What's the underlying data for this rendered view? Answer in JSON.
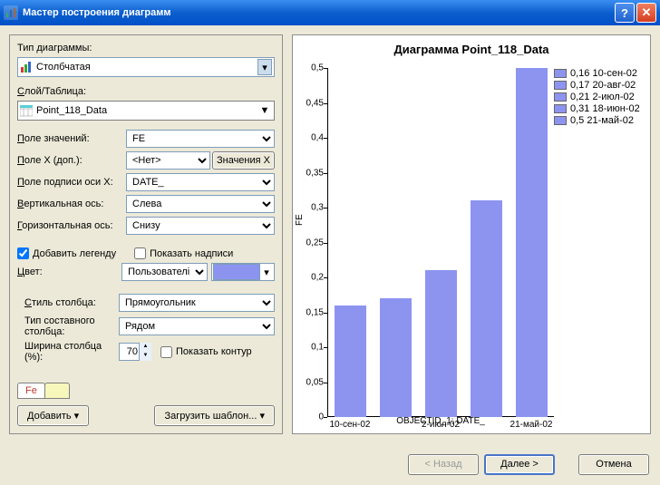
{
  "window": {
    "title": "Мастер построения диаграмм"
  },
  "labels": {
    "chart_type": "Тип диаграммы:",
    "layer_table": "Слой/Таблица:",
    "value_field": "Поле значений:",
    "x_field": "Поле X (доп.):",
    "x_axis_label_field": "Поле подписи оси X:",
    "vertical_axis": "Вертикальная ось:",
    "horizontal_axis": "Горизонтальная ось:",
    "add_legend": "Добавить легенду",
    "show_labels": "Показать надписи",
    "color": "Цвет:",
    "bar_style": "Стиль столбца:",
    "multibar_type": "Тип составного столбца:",
    "bar_width": "Ширина столбца (%):",
    "show_outline": "Показать контур",
    "x_btn": "Значения X",
    "add": "Добавить",
    "load_template": "Загрузить шаблон...",
    "back": "< Назад",
    "next": "Далее >",
    "cancel": "Отмена"
  },
  "values": {
    "chart_type": "Столбчатая",
    "layer_table": "Point_118_Data",
    "value_field": "FE",
    "x_field": "<Нет>",
    "x_axis_label_field": "DATE_",
    "vertical_axis": "Слева",
    "horizontal_axis": "Снизу",
    "add_legend_checked": true,
    "show_labels_checked": false,
    "color_mode": "Пользовательский",
    "color_hex": "#8d94f0",
    "bar_style": "Прямоугольник",
    "multibar_type": "Рядом",
    "bar_width": "70",
    "show_outline_checked": false,
    "tab": "Fe"
  },
  "chart_data": {
    "type": "bar",
    "title": "Диаграмма  Point_118_Data",
    "ylabel": "FE",
    "xlabel": "OBJECTID_1; DATE_",
    "ylim": [
      0,
      0.5
    ],
    "yticks": [
      0,
      0.05,
      0.1,
      0.15,
      0.2,
      0.25,
      0.3,
      0.35,
      0.4,
      0.45,
      0.5
    ],
    "ytick_labels": [
      "0",
      "0,05",
      "0,1",
      "0,15",
      "0,2",
      "0,25",
      "0,3",
      "0,35",
      "0,4",
      "0,45",
      "0,5"
    ],
    "categories": [
      "10-сен-02",
      "20-авг-02",
      "2-июл-02",
      "18-июн-02",
      "21-май-02"
    ],
    "x_tick_labels": [
      "10-сен-02",
      "2-июл-02",
      "21-май-02"
    ],
    "x_tick_positions": [
      0,
      2,
      4
    ],
    "values": [
      0.16,
      0.17,
      0.21,
      0.31,
      0.5
    ],
    "legend": [
      {
        "value": "0,16",
        "label": "10-сен-02"
      },
      {
        "value": "0,17",
        "label": "20-авг-02"
      },
      {
        "value": "0,21",
        "label": "2-июл-02"
      },
      {
        "value": "0,31",
        "label": "18-июн-02"
      },
      {
        "value": "0,5",
        "label": "21-май-02"
      }
    ]
  }
}
